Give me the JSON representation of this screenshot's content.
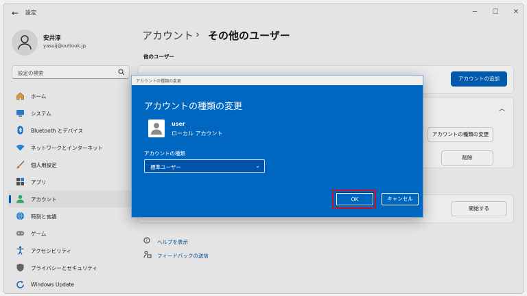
{
  "window": {
    "title": "設定",
    "back": "←",
    "min": "─",
    "max": "☐",
    "close": "✕"
  },
  "profile": {
    "name": "安井淳",
    "email": "yasuij@outlook.jp"
  },
  "search": {
    "placeholder": "設定の検索"
  },
  "sidebar": {
    "items": [
      {
        "label": "ホーム",
        "icon": "home-icon"
      },
      {
        "label": "システム",
        "icon": "monitor-icon"
      },
      {
        "label": "Bluetooth とデバイス",
        "icon": "bluetooth-icon"
      },
      {
        "label": "ネットワークとインターネット",
        "icon": "wifi-icon"
      },
      {
        "label": "個人用設定",
        "icon": "brush-icon"
      },
      {
        "label": "アプリ",
        "icon": "apps-icon"
      },
      {
        "label": "アカウント",
        "icon": "person-icon",
        "active": true
      },
      {
        "label": "時刻と言語",
        "icon": "globe-icon"
      },
      {
        "label": "ゲーム",
        "icon": "gamepad-icon"
      },
      {
        "label": "アクセシビリティ",
        "icon": "accessibility-icon"
      },
      {
        "label": "プライバシーとセキュリティ",
        "icon": "shield-icon"
      },
      {
        "label": "Windows Update",
        "icon": "update-icon"
      }
    ]
  },
  "main": {
    "breadcrumb": {
      "parent": "アカウント",
      "separator": "›",
      "current": "その他のユーザー"
    },
    "section_label": "他のユーザー",
    "add_account_button": "アカウントの追加",
    "change_type_button": "アカウントの種類の変更",
    "delete_button": "削除",
    "start_button": "開始する",
    "chevron": "︿",
    "help_link": "ヘルプを表示",
    "feedback_link": "フィードバックの送信"
  },
  "dialog": {
    "window_title": "アカウントの種類の変更",
    "heading": "アカウントの種類の変更",
    "user_name": "user",
    "user_type": "ローカル アカウント",
    "field_label": "アカウントの種類",
    "selected_value": "標準ユーザー",
    "chevron": "⌄",
    "ok_label": "OK",
    "cancel_label": "キャンセル"
  },
  "colors": {
    "accent": "#005fb8",
    "dialog_bg": "#0067c0",
    "highlight_ring": "#c8102e"
  }
}
